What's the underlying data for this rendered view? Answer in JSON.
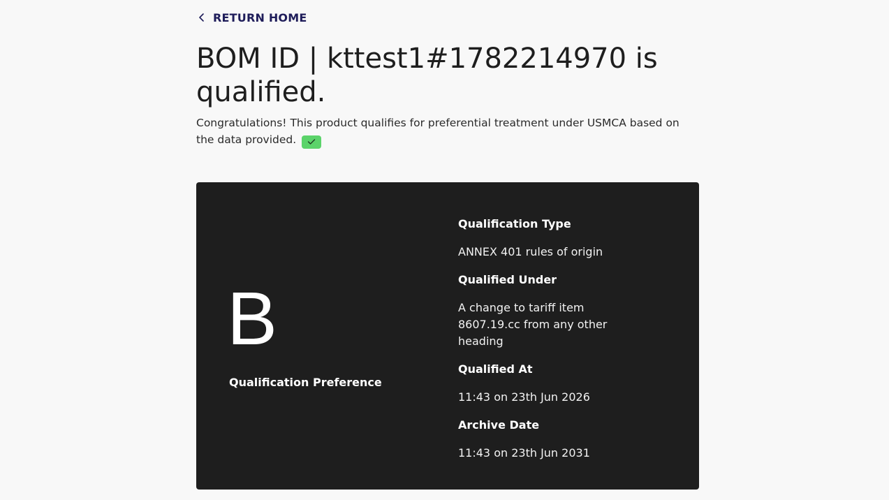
{
  "nav": {
    "return_label": "RETURN HOME"
  },
  "header": {
    "title": "BOM ID | kttest1#1782214970 is qualified.",
    "message": "Congratulations! This product qualifies for preferential treatment under USMCA based on the data provided."
  },
  "card": {
    "grade": "B",
    "grade_label": "Qualification Preference",
    "details": [
      {
        "label": "Qualification Type",
        "value": "ANNEX 401 rules of origin"
      },
      {
        "label": "Qualified Under",
        "value": "A change to tariff item 8607.19.cc from any other heading"
      },
      {
        "label": "Qualified At",
        "value": "11:43 on 23th Jun 2026"
      },
      {
        "label": "Archive Date",
        "value": "11:43 on 23th Jun 2031"
      }
    ]
  },
  "icons": {
    "back": "chevron-left-icon",
    "check": "checkmark-icon"
  },
  "colors": {
    "background": "#f8f8f8",
    "card": "#1e1e1e",
    "link": "#1f1d5a",
    "success": "#5bd36a"
  }
}
